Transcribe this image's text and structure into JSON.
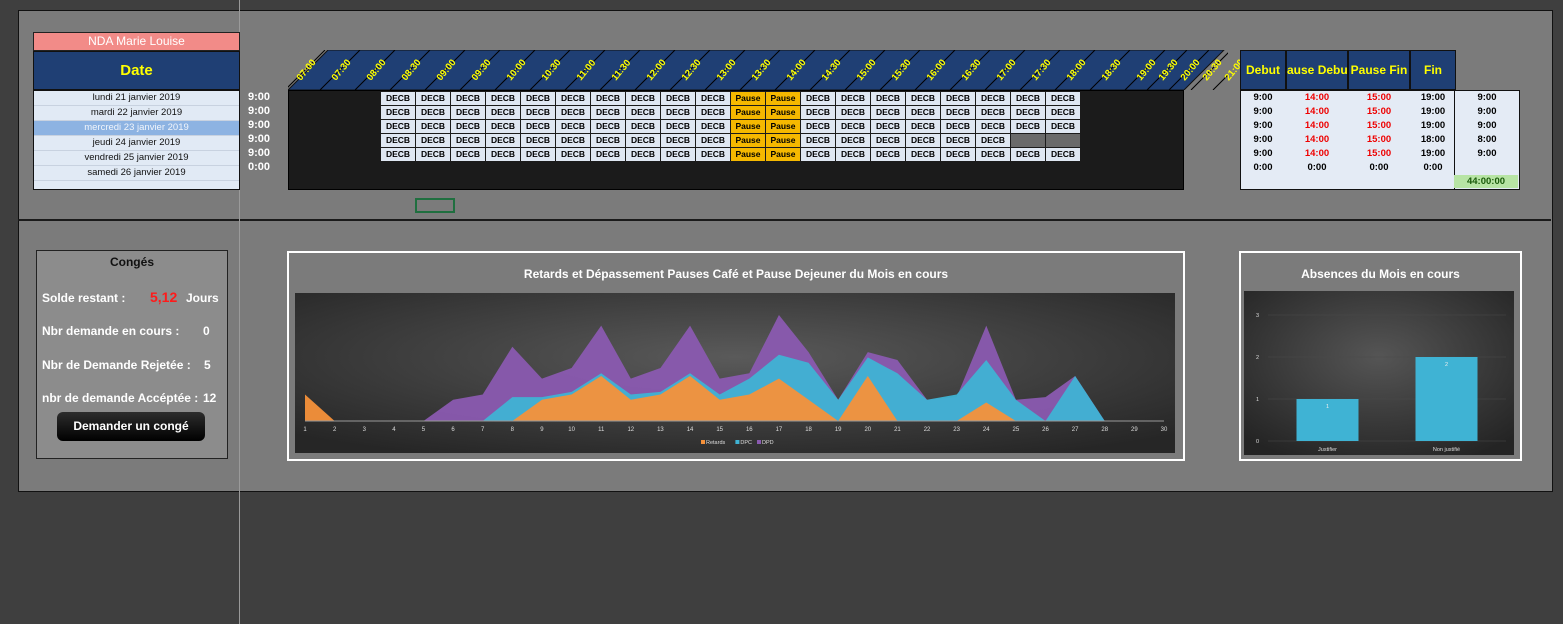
{
  "employee_name": "NDA Marie Louise",
  "date_header": "Date",
  "dates": [
    "lundi 21 janvier 2019",
    "mardi 22 janvier 2019",
    "mercredi 23 janvier 2019",
    "jeudi 24 janvier 2019",
    "vendredi 25 janvier 2019",
    "samedi 26 janvier 2019"
  ],
  "start_hours": [
    "9:00",
    "9:00",
    "9:00",
    "9:00",
    "9:00",
    "0:00"
  ],
  "time_slots": [
    "07:00",
    "07:30",
    "08:00",
    "08:30",
    "09:00",
    "09:30",
    "10:00",
    "10:30",
    "11:00",
    "11:30",
    "12:00",
    "12:30",
    "13:00",
    "13:30",
    "14:00",
    "14:30",
    "15:00",
    "15:30",
    "16:00",
    "16:30",
    "17:00",
    "17:30",
    "18:00",
    "18:30",
    "19:00",
    "19:30",
    "20:00",
    "20:30",
    "21:00"
  ],
  "cell_labels": {
    "work": "DECB",
    "pause": "Pause"
  },
  "summary_headers": [
    "Debut",
    "Pause Debut",
    "Pause Fin",
    "Fin"
  ],
  "summary_rows": [
    [
      "9:00",
      "14:00",
      "15:00",
      "19:00",
      "9:00"
    ],
    [
      "9:00",
      "14:00",
      "15:00",
      "19:00",
      "9:00"
    ],
    [
      "9:00",
      "14:00",
      "15:00",
      "19:00",
      "9:00"
    ],
    [
      "9:00",
      "14:00",
      "15:00",
      "18:00",
      "8:00"
    ],
    [
      "9:00",
      "14:00",
      "15:00",
      "19:00",
      "9:00"
    ],
    [
      "0:00",
      "0:00",
      "0:00",
      "0:00",
      ""
    ]
  ],
  "total_hours": "44:00:00",
  "conges": {
    "title": "Congés",
    "solde_label": "Solde restant :",
    "solde_value": "5,12",
    "solde_unit": "Jours",
    "en_cours_label": "Nbr demande en cours :",
    "en_cours_value": "0",
    "rejetee_label": "Nbr de Demande Rejetée :",
    "rejetee_value": "5",
    "acceptee_label": "nbr de demande Accéptée :",
    "acceptee_value": "12",
    "button_label": "Demander un congé"
  },
  "chart_data": [
    {
      "type": "area",
      "title": "Retards et Dépassement Pauses Café et Pause Dejeuner du Mois en cours",
      "x": [
        1,
        2,
        3,
        4,
        5,
        6,
        7,
        8,
        9,
        10,
        11,
        12,
        13,
        14,
        15,
        16,
        17,
        18,
        19,
        20,
        21,
        22,
        23,
        24,
        25,
        26,
        27,
        28,
        29,
        30
      ],
      "series": [
        {
          "name": "Retards",
          "color": "#f5913a",
          "values": [
            1.0,
            0,
            0,
            0,
            0,
            0,
            0,
            0,
            0.8,
            1.0,
            1.7,
            0.8,
            1.0,
            1.7,
            0.8,
            1.0,
            1.6,
            0.8,
            0,
            1.7,
            0,
            0,
            0,
            0.7,
            0,
            0,
            0,
            0,
            0,
            0
          ]
        },
        {
          "name": "DPC",
          "color": "#3fb3d4",
          "values": [
            0,
            0,
            0,
            0,
            0,
            0,
            0,
            0.9,
            0.9,
            1.1,
            1.8,
            1.0,
            1.1,
            1.8,
            1.0,
            1.6,
            2.5,
            2.2,
            0.8,
            2.4,
            1.8,
            0.8,
            1.0,
            2.3,
            0.8,
            0,
            1.7,
            0,
            0,
            0
          ]
        },
        {
          "name": "DPD",
          "color": "#8a5ab0",
          "values": [
            0,
            0,
            0,
            0,
            0,
            0.8,
            1.0,
            2.8,
            1.6,
            2.0,
            3.6,
            1.6,
            2.0,
            3.6,
            1.6,
            1.8,
            4.0,
            2.6,
            0.8,
            2.6,
            2.3,
            0.8,
            0.9,
            3.6,
            0.8,
            0.9,
            1.7,
            0,
            0,
            0
          ]
        }
      ],
      "legend": "bottom"
    },
    {
      "type": "bar",
      "title": "Absences du Mois en cours",
      "categories": [
        "Justifier",
        "Non justifié"
      ],
      "values": [
        1,
        2
      ],
      "ylim": [
        0,
        3
      ],
      "color": "#3fb3d4"
    }
  ]
}
